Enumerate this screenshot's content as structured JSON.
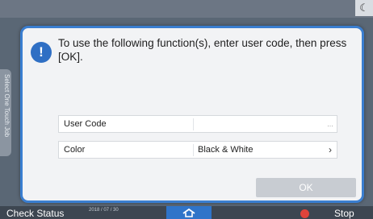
{
  "dialog": {
    "message": "To use the following function(s), enter user code, then press [OK].",
    "fields": [
      {
        "label": "User Code",
        "value": ""
      },
      {
        "label": "Color",
        "value": "Black & White"
      }
    ],
    "ok_label": "OK"
  },
  "background": {
    "side_tab_label": "Select One Touch Job",
    "status_label": "Check Status",
    "date": "2018 / 07 / 30",
    "stop_label": "Stop"
  },
  "colors": {
    "accent": "#3a7ed0",
    "ok_disabled": "#c8ccd2",
    "stop": "#e0433b"
  }
}
